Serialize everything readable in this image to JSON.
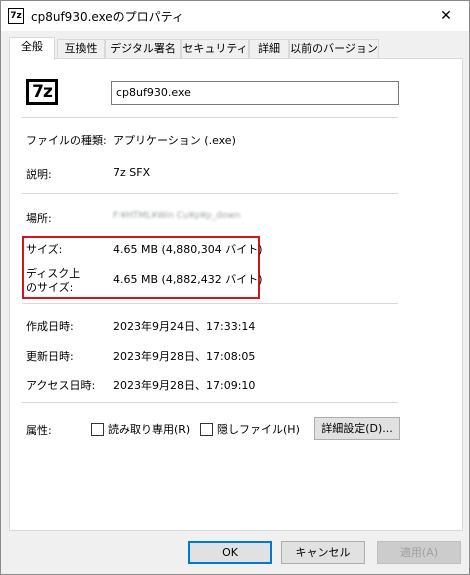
{
  "window": {
    "title": "cp8uf930.exeのプロパティ",
    "app_icon_text": "7z",
    "close_glyph": "✕"
  },
  "tabs": [
    {
      "label": "全般",
      "active": true
    },
    {
      "label": "互換性"
    },
    {
      "label": "デジタル署名"
    },
    {
      "label": "セキュリティ"
    },
    {
      "label": "詳細"
    },
    {
      "label": "以前のバージョン"
    }
  ],
  "general": {
    "icon_text": "7z",
    "file_name": "cp8uf930.exe",
    "file_type_label": "ファイルの種類:",
    "file_type_value": "アプリケーション (.exe)",
    "description_label": "説明:",
    "description_value": "7z SFX",
    "location_label": "場所:",
    "location_value": "F:¥HTML¥Win Cu¥p¥p_down",
    "size_label": "サイズ:",
    "size_value": "4.65 MB (4,880,304 バイト)",
    "disk_size_label_line1": "ディスク上",
    "disk_size_label_line2": "のサイズ:",
    "disk_size_value": "4.65 MB (4,882,432 バイト)",
    "created_label": "作成日時:",
    "created_value": "2023年9月24日、17:33:14",
    "modified_label": "更新日時:",
    "modified_value": "2023年9月28日、17:08:05",
    "accessed_label": "アクセス日時:",
    "accessed_value": "2023年9月28日、17:09:10",
    "attributes_label": "属性:",
    "readonly_label": "読み取り専用(R)",
    "hidden_label": "隠しファイル(H)",
    "advanced_button": "詳細設定(D)..."
  },
  "footer": {
    "ok": "OK",
    "cancel": "キャンセル",
    "apply": "適用(A)"
  },
  "colors": {
    "highlight_border": "#d4141b",
    "default_button_border": "#0078d7"
  }
}
